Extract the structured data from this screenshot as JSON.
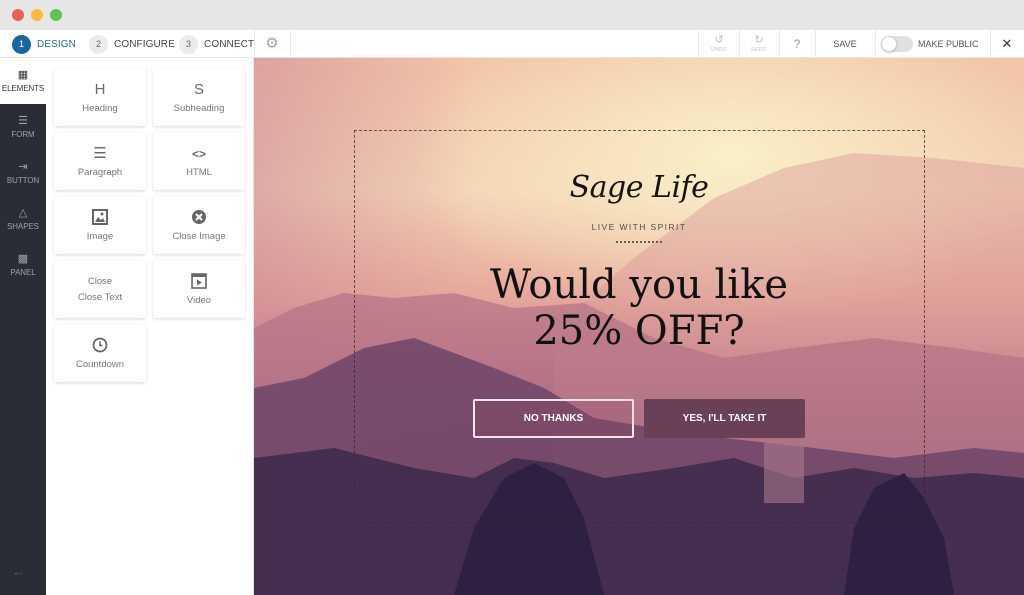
{
  "window": {
    "traffic_lights": [
      "close",
      "minimize",
      "maximize"
    ]
  },
  "toolbar": {
    "steps": [
      {
        "num": "1",
        "label": "DESIGN",
        "active": true
      },
      {
        "num": "2",
        "label": "CONFIGURE",
        "active": false
      },
      {
        "num": "3",
        "label": "CONNECT",
        "active": false
      }
    ],
    "settings_icon": "gear-icon",
    "undo_label": "UNDO",
    "redo_label": "REDO",
    "help_label": "?",
    "save_label": "SAVE",
    "make_public_label": "MAKE PUBLIC",
    "make_public_on": false,
    "close_label": "✕",
    "accent_color": "#1767a0"
  },
  "rail": {
    "items": [
      {
        "label": "ELEMENTS",
        "icon": "grid-icon",
        "active": true
      },
      {
        "label": "FORM",
        "icon": "form-list-icon",
        "active": false
      },
      {
        "label": "BUTTON",
        "icon": "button-icon",
        "active": false
      },
      {
        "label": "SHAPES",
        "icon": "shapes-icon",
        "active": false
      },
      {
        "label": "PANEL",
        "icon": "panel-hatch-icon",
        "active": false
      }
    ],
    "back_icon": "arrow-left-icon"
  },
  "elements": {
    "tiles": [
      {
        "label": "Heading",
        "glyph": "H",
        "icon": "heading-icon"
      },
      {
        "label": "Subheading",
        "glyph": "S",
        "icon": "subheading-icon"
      },
      {
        "label": "Paragraph",
        "glyph": "☰",
        "icon": "paragraph-icon"
      },
      {
        "label": "HTML",
        "glyph": "<>",
        "icon": "code-icon"
      },
      {
        "label": "Image",
        "glyph": "🖼",
        "icon": "image-icon"
      },
      {
        "label": "Close Image",
        "glyph": "⊗",
        "icon": "close-circle-icon"
      },
      {
        "label": "Close Text",
        "top_text": "Close",
        "icon": "close-text"
      },
      {
        "label": "Video",
        "glyph": "▶",
        "icon": "video-icon"
      },
      {
        "label": "Countdown",
        "glyph": "◷",
        "icon": "clock-icon"
      }
    ]
  },
  "popup": {
    "logo_text": "Sage Life",
    "tagline": "LIVE WITH SPIRIT",
    "headline_line1": "Would you like",
    "headline_line2": "25% OFF?",
    "decline_button": "NO THANKS",
    "accept_button": "YES, I'LL TAKE IT",
    "accept_color": "#6a4058"
  }
}
